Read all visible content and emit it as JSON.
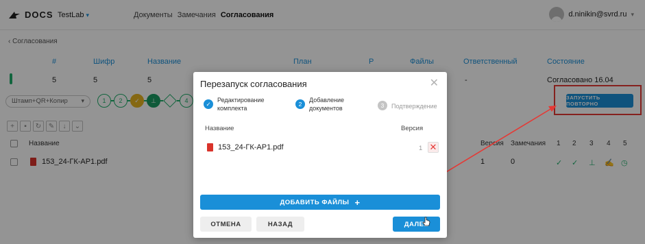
{
  "header": {
    "logo": "DOCS",
    "project": "TestLab",
    "nav": [
      "Документы",
      "Замечания",
      "Согласования"
    ],
    "user": "d.ninikin@svrd.ru"
  },
  "breadcrumb": "Согласования",
  "table": {
    "columns": [
      "#",
      "Шифр",
      "Название",
      "План",
      "Р",
      "Файлы",
      "Ответственный",
      "Состояние"
    ],
    "row": {
      "num": "5",
      "code": "5",
      "name": "5",
      "resp": "-",
      "state": "Согласовано 16.04"
    }
  },
  "stamp_select": "Штамп+QR+Копир",
  "steps": [
    "1",
    "2",
    "✓",
    "",
    "4"
  ],
  "relaunch_label": "ЗАПУСТИТЬ ПОВТОРНО",
  "list": {
    "headers": {
      "name": "Название",
      "version": "Версия",
      "remarks": "Замечания",
      "cols": [
        "1",
        "2",
        "3",
        "4",
        "5"
      ]
    },
    "row": {
      "file": "153_24-ГК-АР1.pdf",
      "version": "1",
      "remarks": "0"
    }
  },
  "modal": {
    "title": "Перезапуск согласования",
    "wizard": [
      {
        "num": "",
        "label_1": "Редактирование",
        "label_2": "комплекта"
      },
      {
        "num": "2",
        "label_1": "Добавление",
        "label_2": "документов"
      },
      {
        "num": "3",
        "label_1": "Подтверждение",
        "label_2": ""
      }
    ],
    "col_name": "Название",
    "col_version": "Версия",
    "file": {
      "name": "153_24-ГК-АР1.pdf",
      "version": "1"
    },
    "add_files": "ДОБАВИТЬ ФАЙЛЫ",
    "cancel": "ОТМЕНА",
    "back": "НАЗАД",
    "next": "ДАЛЕЕ"
  },
  "colors": {
    "accent": "#1a8fd8",
    "success": "#1fae6b",
    "highlight": "#e53935"
  }
}
